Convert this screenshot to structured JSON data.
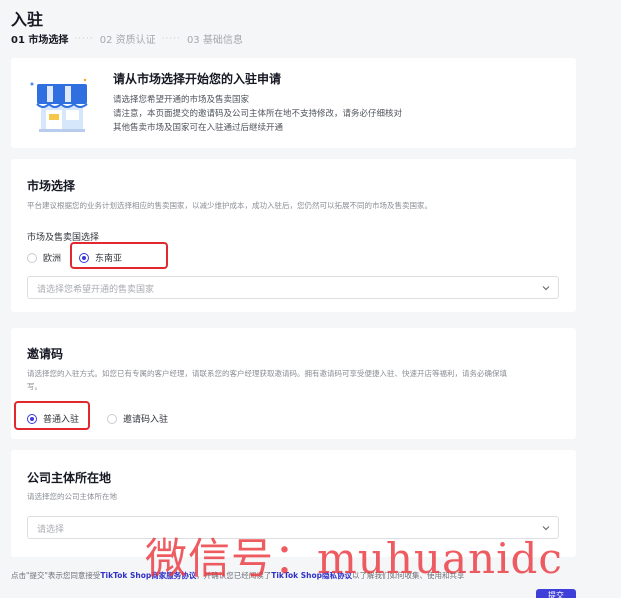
{
  "header": {
    "title": "入驻",
    "steps": [
      {
        "label": "01 市场选择",
        "active": true
      },
      {
        "label": "02 资质认证",
        "active": false
      },
      {
        "label": "03 基础信息",
        "active": false
      }
    ],
    "step_separator": "·····"
  },
  "intro": {
    "title": "请从市场选择开始您的入驻申请",
    "lines": [
      "请选择您希望开通的市场及售卖国家",
      "请注意，本页面提交的邀请码及公司主体所在地不支持修改，请务必仔细核对",
      "其他售卖市场及国家可在入驻通过后继续开通"
    ]
  },
  "market": {
    "title": "市场选择",
    "description": "平台建议根据您的业务计划选择相应的售卖国家，以减少维护成本，成功入驻后，您仍然可以拓展不同的市场及售卖国家。",
    "sub_label": "市场及售卖国选择",
    "options": [
      {
        "label": "欧洲",
        "checked": false
      },
      {
        "label": "东南亚",
        "checked": true
      }
    ],
    "country_placeholder": "请选择您希望开通的售卖国家"
  },
  "invite": {
    "title": "邀请码",
    "description_lines": [
      "请选择您的入驻方式。如您已有专属的客户经理，请联系您的客户经理获取邀请码。拥有邀请码可享受便捷入驻、快速开店等福利，请务必确保填",
      "写。"
    ],
    "options": [
      {
        "label": "普通入驻",
        "checked": true
      },
      {
        "label": "邀请码入驻",
        "checked": false
      }
    ]
  },
  "company": {
    "title": "公司主体所在地",
    "description": "请选择您的公司主体所在地",
    "placeholder": "请选择"
  },
  "footer": {
    "prefix": "点击\"提交\"表示您同意接受",
    "link1": "TikTok Shop商家服务协议",
    "middle": "，并确认您已经阅读了",
    "link2": "TikTok Shop隐私协议",
    "suffix": "以了解我们如何收集、使用和共享",
    "submit_label": "提交"
  },
  "watermark": "微信号：muhuanidc",
  "colors": {
    "accent": "#3a3bd6",
    "highlight": "#e0282e",
    "watermark": "#ea3840"
  }
}
